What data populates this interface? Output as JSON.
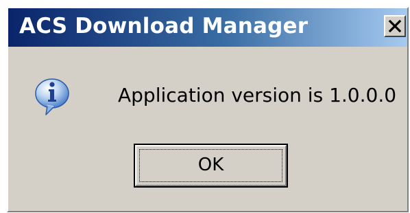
{
  "window": {
    "title": "ACS Download Manager",
    "close_icon": "close-icon"
  },
  "dialog": {
    "icon": "info-icon",
    "message": "Application version is 1.0.0.0",
    "ok_label": "OK"
  },
  "colors": {
    "title_start": "#0a246a",
    "title_end": "#a6caf0",
    "face": "#d4d0c8"
  }
}
